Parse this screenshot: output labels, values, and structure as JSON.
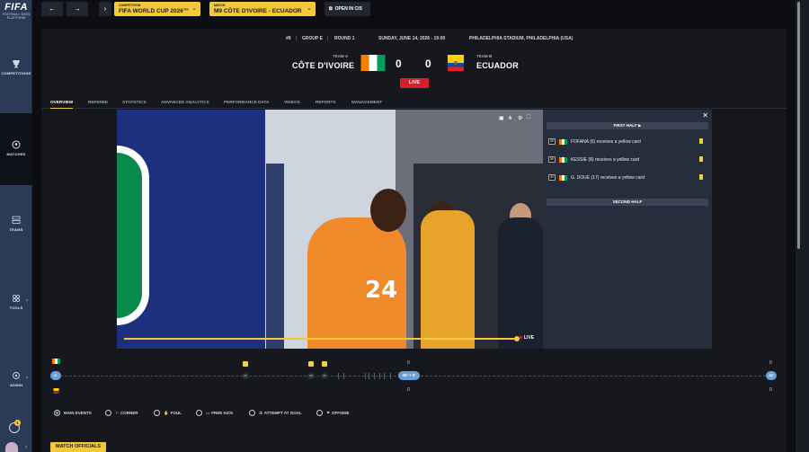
{
  "sidebar": {
    "logo_text": "FIFA",
    "logo_sub": "FOOTBALL DATA PLATFORM",
    "items": [
      {
        "label": "COMPETITIONS"
      },
      {
        "label": "MATCHES"
      },
      {
        "label": "TEAMS"
      },
      {
        "label": "TOOLS"
      },
      {
        "label": "ADMIN"
      }
    ],
    "notification_count": "1"
  },
  "topbar": {
    "back_glyph": "←",
    "forward_glyph": "→",
    "expand_glyph": "›",
    "competition_caption": "COMPETITION",
    "competition_value": "FIFA WORLD CUP 2026™",
    "match_caption": "MATCH",
    "match_value": "M9 CÔTE D'IVOIRE - ECUADOR",
    "open_cis_label": "OPEN IN CIS"
  },
  "match": {
    "number": "#9",
    "group": "GROUP E",
    "round": "ROUND 1",
    "datetime": "SUNDAY, JUNE 14, 2026 - 19:00",
    "venue": "PHILADELPHIA STADIUM, PHILADELPHIA (USA)",
    "team_a_caption": "TEAM A",
    "team_a_name": "CÔTE D'IVOIRE",
    "team_a_score": "0",
    "team_b_caption": "TEAM B",
    "team_b_name": "ECUADOR",
    "team_b_score": "0",
    "status": "LIVE"
  },
  "tabs": [
    {
      "label": "OVERVIEW",
      "active": true
    },
    {
      "label": "REFEREE"
    },
    {
      "label": "STATISTICS"
    },
    {
      "label": "ADVANCED ANALYTICS"
    },
    {
      "label": "PERFORMANCE DATA"
    },
    {
      "label": "VIDEOS"
    },
    {
      "label": "REPORTS"
    },
    {
      "label": "MANAGEMENT"
    }
  ],
  "video": {
    "live_label": "LIVE",
    "progress_fraction": 0.97
  },
  "events": {
    "close_glyph": "✕",
    "first_half_label": "FIRST HALF  ▶",
    "second_half_label": "SECOND HALF",
    "items": [
      {
        "minute": "28'",
        "text": "FOFANA (6) receives a yellow card"
      },
      {
        "minute": "38'",
        "text": "KESSIE (8) receives a yellow card"
      },
      {
        "minute": "40'",
        "text": "G. DOUE (17) receives a yellow card"
      }
    ]
  },
  "timeline": {
    "start_label": "0'",
    "mid_label": "45' + 5'",
    "end_label": "90'",
    "team_a_count_left": "0",
    "team_a_count_right": "0",
    "team_b_count_left": "0",
    "team_b_count_right": "0",
    "event_minutes": [
      "28'",
      "38'",
      "40'"
    ]
  },
  "filters": [
    {
      "label": "MAIN EVENTS",
      "selected": true,
      "icon": ""
    },
    {
      "label": "CORNER",
      "icon": "⚐"
    },
    {
      "label": "FOUL",
      "icon": "✋"
    },
    {
      "label": "FREE KICK",
      "icon": "▭"
    },
    {
      "label": "ATTEMPT AT GOAL",
      "icon": "⇉"
    },
    {
      "label": "OFFSIDE",
      "icon": "⚑"
    }
  ],
  "officials_label": "MATCH OFFICIALS",
  "colors": {
    "accent_yellow": "#f4c83b",
    "live_red": "#d51f2b",
    "sidebar_blue": "#2a3a57",
    "timeline_blue": "#6aa0d8"
  }
}
